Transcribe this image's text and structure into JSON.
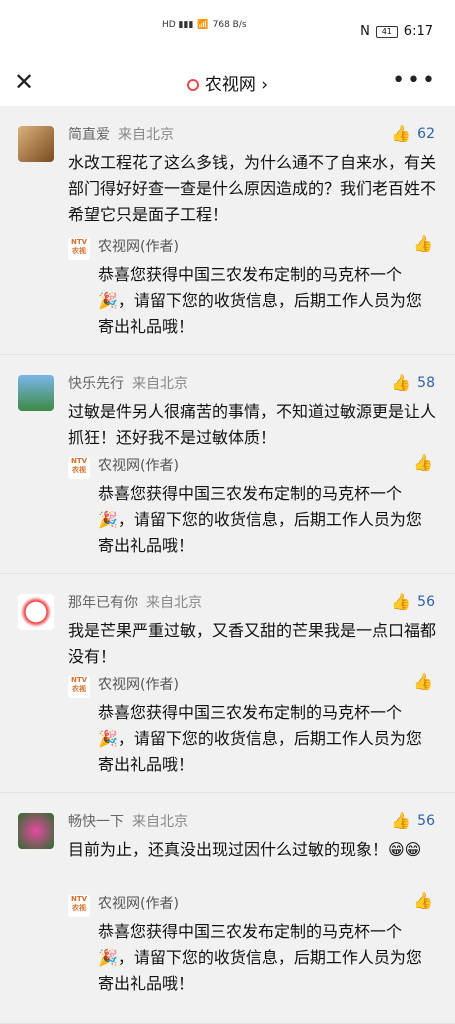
{
  "status": {
    "net_speed": "768 B/s",
    "battery": "41",
    "time": "6:17"
  },
  "nav": {
    "title": "农视网",
    "chevron": "›"
  },
  "comments": [
    {
      "name": "简直爱",
      "location": "来自北京",
      "likes": "62",
      "text": "水改工程花了这么多钱，为什么通不了自来水，有关部门得好好查一查是什么原因造成的？我们老百姓不希望它只是面子工程！",
      "reply_name": "农视网(作者)",
      "reply_text": "恭喜您获得中国三农发布定制的马克杯一个🎉，请留下您的收货信息，后期工作人员为您寄出礼品哦！"
    },
    {
      "name": "快乐先行",
      "location": "来自北京",
      "likes": "58",
      "text": "过敏是件另人很痛苦的事情，不知道过敏源更是让人抓狂！还好我不是过敏体质！",
      "reply_name": "农视网(作者)",
      "reply_text": "恭喜您获得中国三农发布定制的马克杯一个🎉，请留下您的收货信息，后期工作人员为您寄出礼品哦！"
    },
    {
      "name": "那年已有你",
      "location": "来自北京",
      "likes": "56",
      "text": "我是芒果严重过敏，又香又甜的芒果我是一点口福都没有！",
      "reply_name": "农视网(作者)",
      "reply_text": "恭喜您获得中国三农发布定制的马克杯一个🎉，请留下您的收货信息，后期工作人员为您寄出礼品哦！"
    },
    {
      "name": "畅快一下",
      "location": "来自北京",
      "likes": "56",
      "text": "目前为止，还真没出现过因什么过敏的现象！😁😁",
      "reply_name": "农视网(作者)",
      "reply_text": "恭喜您获得中国三农发布定制的马克杯一个🎉，请留下您的收货信息，后期工作人员为您寄出礼品哦！"
    }
  ],
  "logo_text": "NTV农视"
}
